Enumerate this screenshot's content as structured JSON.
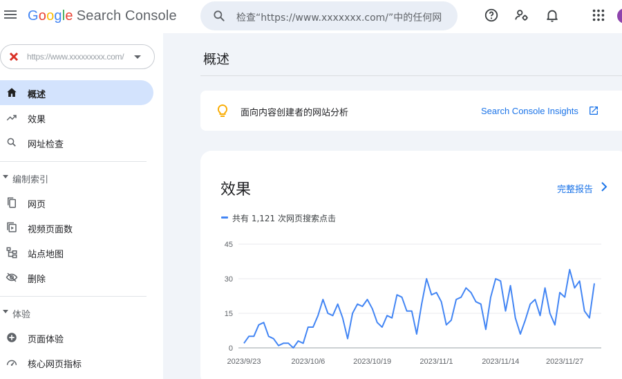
{
  "app": {
    "logo_google": "Google",
    "logo_product": "Search Console",
    "colors": {
      "blue": "#4285f4",
      "red": "#ea4335",
      "yellow": "#fbbc05",
      "green": "#34a853",
      "link": "#1a73e8",
      "active_nav": "#d3e3fd"
    }
  },
  "header": {
    "search_placeholder": "检查“https://www.xxxxxxx.com/”中的任何网",
    "icons": [
      "menu-icon",
      "search-icon",
      "help-icon",
      "user-settings-icon",
      "notifications-icon",
      "apps-grid-icon",
      "avatar"
    ]
  },
  "sidebar": {
    "property_url": "https://www.xxxxxxxxx.com/",
    "items": [
      {
        "label": "概述",
        "icon": "home-icon",
        "active": true
      },
      {
        "label": "效果",
        "icon": "trending-up-icon",
        "active": false
      },
      {
        "label": "网址检查",
        "icon": "search-icon",
        "active": false
      }
    ],
    "section_index": {
      "label": "编制索引",
      "items": [
        {
          "label": "网页",
          "icon": "pages-icon"
        },
        {
          "label": "视频页面数",
          "icon": "video-pages-icon"
        },
        {
          "label": "站点地图",
          "icon": "sitemap-icon"
        },
        {
          "label": "删除",
          "icon": "removals-icon"
        }
      ]
    },
    "section_experience": {
      "label": "体验",
      "items": [
        {
          "label": "页面体验",
          "icon": "page-experience-icon"
        },
        {
          "label": "核心网页指标",
          "icon": "core-web-vitals-icon"
        }
      ]
    }
  },
  "main": {
    "page_title": "概述",
    "insights": {
      "text": "面向内容创建者的网站分析",
      "link": "Search Console Insights"
    },
    "performance": {
      "title": "效果",
      "report_link": "完整报告",
      "legend": "共有 1,121 次网页搜索点击"
    }
  },
  "chart_data": {
    "type": "line",
    "title": "",
    "xlabel": "",
    "ylabel": "",
    "ylim": [
      0,
      45
    ],
    "yticks": [
      0,
      15,
      30,
      45
    ],
    "x_tick_labels": [
      "2023/9/23",
      "2023/10/6",
      "2023/10/19",
      "2023/11/1",
      "2023/11/14",
      "2023/11/27"
    ],
    "x_tick_index": [
      0,
      13,
      26,
      39,
      52,
      65
    ],
    "grid": true,
    "color": "#4285f4",
    "series": [
      {
        "name": "",
        "values": [
          2,
          5,
          5,
          10,
          11,
          5,
          4,
          1,
          2,
          2,
          0,
          3,
          2,
          9,
          9,
          14,
          21,
          15,
          14,
          19,
          13,
          4,
          15,
          19,
          18,
          21,
          17,
          11,
          9,
          14,
          13,
          23,
          22,
          16,
          16,
          6,
          19,
          30,
          23,
          24,
          20,
          10,
          12,
          21,
          22,
          26,
          24,
          20,
          19,
          8,
          22,
          30,
          29,
          16,
          27,
          13,
          6,
          12,
          19,
          21,
          14,
          26,
          15,
          10,
          24,
          22,
          34,
          26,
          29,
          16,
          13,
          28
        ]
      }
    ]
  }
}
